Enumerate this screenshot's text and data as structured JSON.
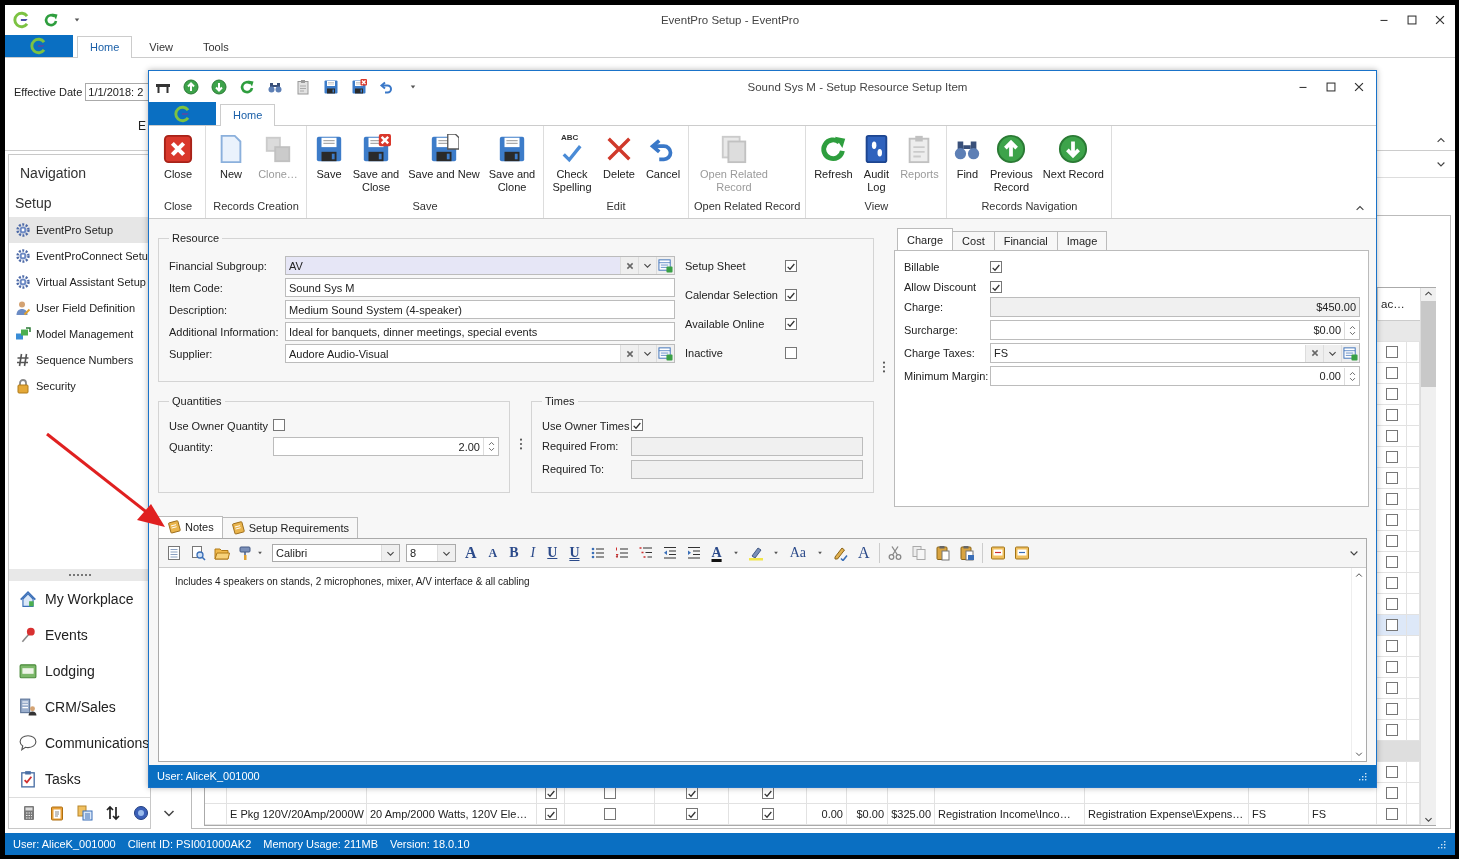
{
  "app": {
    "title": "EventPro Setup - EventPro",
    "tabs": [
      {
        "label": "Home",
        "selected": true
      },
      {
        "label": "View",
        "selected": false
      },
      {
        "label": "Tools",
        "selected": false
      }
    ],
    "effective_date": {
      "label": "Effective Date",
      "value": "1/1/2018: 2"
    },
    "group_label": "E"
  },
  "navigation": {
    "title": "Navigation",
    "section": "Setup",
    "items": [
      {
        "label": "EventPro Setup",
        "selected": true
      },
      {
        "label": "EventProConnect Setu",
        "selected": false
      },
      {
        "label": "Virtual Assistant Setup",
        "selected": false
      },
      {
        "label": "User Field Definition",
        "selected": false
      },
      {
        "label": "Model Management",
        "selected": false
      },
      {
        "label": "Sequence Numbers",
        "selected": false
      },
      {
        "label": "Security",
        "selected": false
      }
    ],
    "modules": [
      {
        "label": "My Workplace"
      },
      {
        "label": "Events"
      },
      {
        "label": "Lodging"
      },
      {
        "label": "CRM/Sales"
      },
      {
        "label": "Communications"
      },
      {
        "label": "Tasks"
      }
    ]
  },
  "grid": {
    "last_column_header": "ac…",
    "rows": [
      {
        "kind": "item",
        "selected": false,
        "checked": false
      },
      {
        "kind": "item",
        "selected": false,
        "checked": false
      },
      {
        "kind": "item",
        "selected": false,
        "checked": false
      },
      {
        "kind": "item",
        "selected": false,
        "checked": false
      },
      {
        "kind": "item",
        "selected": false,
        "checked": false
      },
      {
        "kind": "item",
        "selected": false,
        "checked": false
      },
      {
        "kind": "item",
        "selected": false,
        "checked": false
      },
      {
        "kind": "item",
        "selected": false,
        "checked": false
      },
      {
        "kind": "item",
        "selected": false,
        "checked": false
      },
      {
        "kind": "item",
        "selected": false,
        "checked": false
      },
      {
        "kind": "item",
        "selected": false,
        "checked": false
      },
      {
        "kind": "item",
        "selected": false,
        "checked": false
      },
      {
        "kind": "item",
        "selected": false,
        "checked": false
      },
      {
        "kind": "item",
        "selected": true,
        "checked": false
      },
      {
        "kind": "item",
        "selected": false,
        "checked": false
      },
      {
        "kind": "item",
        "selected": false,
        "checked": false
      },
      {
        "kind": "item",
        "selected": false,
        "checked": false
      },
      {
        "kind": "item",
        "selected": false,
        "checked": false
      },
      {
        "kind": "item",
        "selected": false,
        "checked": false
      },
      {
        "kind": "group"
      },
      {
        "kind": "item",
        "selected": false,
        "checked": false
      },
      {
        "kind": "item",
        "selected": false,
        "checked": false,
        "checks": [
          true,
          false,
          true,
          true
        ]
      },
      {
        "kind": "item",
        "selected": false,
        "checked": false,
        "checks": [
          true,
          false,
          true,
          true
        ],
        "cells": [
          "E Pkg 120V/20Amp/2000W",
          "20 Amp/2000 Watts, 120V Ele…",
          "0.00",
          "$0.00",
          "$325.00",
          "Registration Income\\Inco…",
          "Registration Expense\\Expens…",
          "FS",
          "FS"
        ]
      }
    ]
  },
  "status_bar": [
    "User: AliceK_001000",
    "Client ID: PSI001000AK2",
    "Memory Usage: 211MB",
    "Version: 18.0.10"
  ],
  "dialog": {
    "title": "Sound Sys M - Setup Resource Setup Item",
    "tabs": [
      {
        "label": "Home",
        "selected": true
      }
    ],
    "ribbon": [
      {
        "group": "Close",
        "buttons": [
          {
            "label": "Close",
            "disabled": false
          }
        ]
      },
      {
        "group": "Records Creation",
        "buttons": [
          {
            "label": "New",
            "disabled": false
          },
          {
            "label": "Clone…",
            "disabled": true
          }
        ]
      },
      {
        "group": "Save",
        "buttons": [
          {
            "label": "Save",
            "disabled": false
          },
          {
            "label": "Save and Close",
            "disabled": false
          },
          {
            "label": "Save and New",
            "disabled": false
          },
          {
            "label": "Save and Clone",
            "disabled": false
          }
        ]
      },
      {
        "group": "Edit",
        "buttons": [
          {
            "label": "Check Spelling",
            "badge": "ABC",
            "disabled": false
          },
          {
            "label": "Delete",
            "disabled": false
          },
          {
            "label": "Cancel",
            "disabled": false
          }
        ]
      },
      {
        "group": "Open Related Record",
        "buttons": [
          {
            "label": "Open Related Record",
            "disabled": true
          }
        ]
      },
      {
        "group": "View",
        "buttons": [
          {
            "label": "Refresh",
            "disabled": false
          },
          {
            "label": "Audit Log",
            "disabled": false
          },
          {
            "label": "Reports",
            "disabled": true
          }
        ]
      },
      {
        "group": "Records Navigation",
        "buttons": [
          {
            "label": "Find",
            "disabled": false
          },
          {
            "label": "Previous Record",
            "disabled": false
          },
          {
            "label": "Next Record",
            "disabled": false
          }
        ]
      }
    ],
    "resource": {
      "title": "Resource",
      "fields": [
        {
          "label": "Financial Subgroup:",
          "value": "AV",
          "kind": "lookup",
          "focused": true
        },
        {
          "label": "Item Code:",
          "value": "Sound Sys M",
          "kind": "text",
          "focused": false
        },
        {
          "label": "Description:",
          "value": "Medium Sound System (4-speaker)",
          "kind": "text",
          "focused": false
        },
        {
          "label": "Additional Information:",
          "value": "Ideal for banquets, dinner meetings, special events",
          "kind": "text",
          "focused": false
        },
        {
          "label": "Supplier:",
          "value": "Audore Audio-Visual",
          "kind": "lookup",
          "focused": false
        }
      ],
      "flags": [
        {
          "label": "Setup Sheet",
          "checked": true
        },
        {
          "label": "Calendar Selection",
          "checked": true
        },
        {
          "label": "Available Online",
          "checked": true
        },
        {
          "label": "Inactive",
          "checked": false
        }
      ]
    },
    "quantities": {
      "title": "Quantities",
      "flag": {
        "label": "Use Owner Quantity",
        "checked": false
      },
      "fields": [
        {
          "label": "Quantity:",
          "value": "2.00",
          "kind": "spin"
        }
      ]
    },
    "times": {
      "title": "Times",
      "flag": {
        "label": "Use Owner Times",
        "checked": true
      },
      "fields": [
        {
          "label": "Required From:",
          "kind": "readonly"
        },
        {
          "label": "Required To:",
          "kind": "readonly"
        }
      ]
    },
    "charge_panel": {
      "tabs": [
        {
          "label": "Charge",
          "selected": true
        },
        {
          "label": "Cost",
          "selected": false
        },
        {
          "label": "Financial",
          "selected": false
        },
        {
          "label": "Image",
          "selected": false
        }
      ],
      "flags": [
        {
          "label": "Billable",
          "checked": true
        },
        {
          "label": "Allow Discount",
          "checked": true
        }
      ],
      "fields": [
        {
          "label": "Charge:",
          "value": "$450.00",
          "kind": "readonly"
        },
        {
          "label": "Surcharge:",
          "value": "$0.00",
          "kind": "spin"
        },
        {
          "label": "Charge Taxes:",
          "value": "FS",
          "kind": "lookup"
        },
        {
          "label": "Minimum Margin:",
          "value": "0.00",
          "kind": "spin"
        }
      ]
    },
    "notes": {
      "tabs": [
        {
          "label": "Notes",
          "selected": true
        },
        {
          "label": "Setup Requirements",
          "selected": false
        }
      ],
      "font": "Calibri",
      "size": "8",
      "format_buttons": [
        "A",
        "A",
        "B",
        "I",
        "U",
        "U"
      ],
      "font_color_button": "A",
      "case_button": "Aa",
      "clear_format_button": "A",
      "text": "Includes 4 speakers on stands, 2 microphones, mixer, A/V interface & all cabling"
    },
    "status": "User: AliceK_001000"
  }
}
